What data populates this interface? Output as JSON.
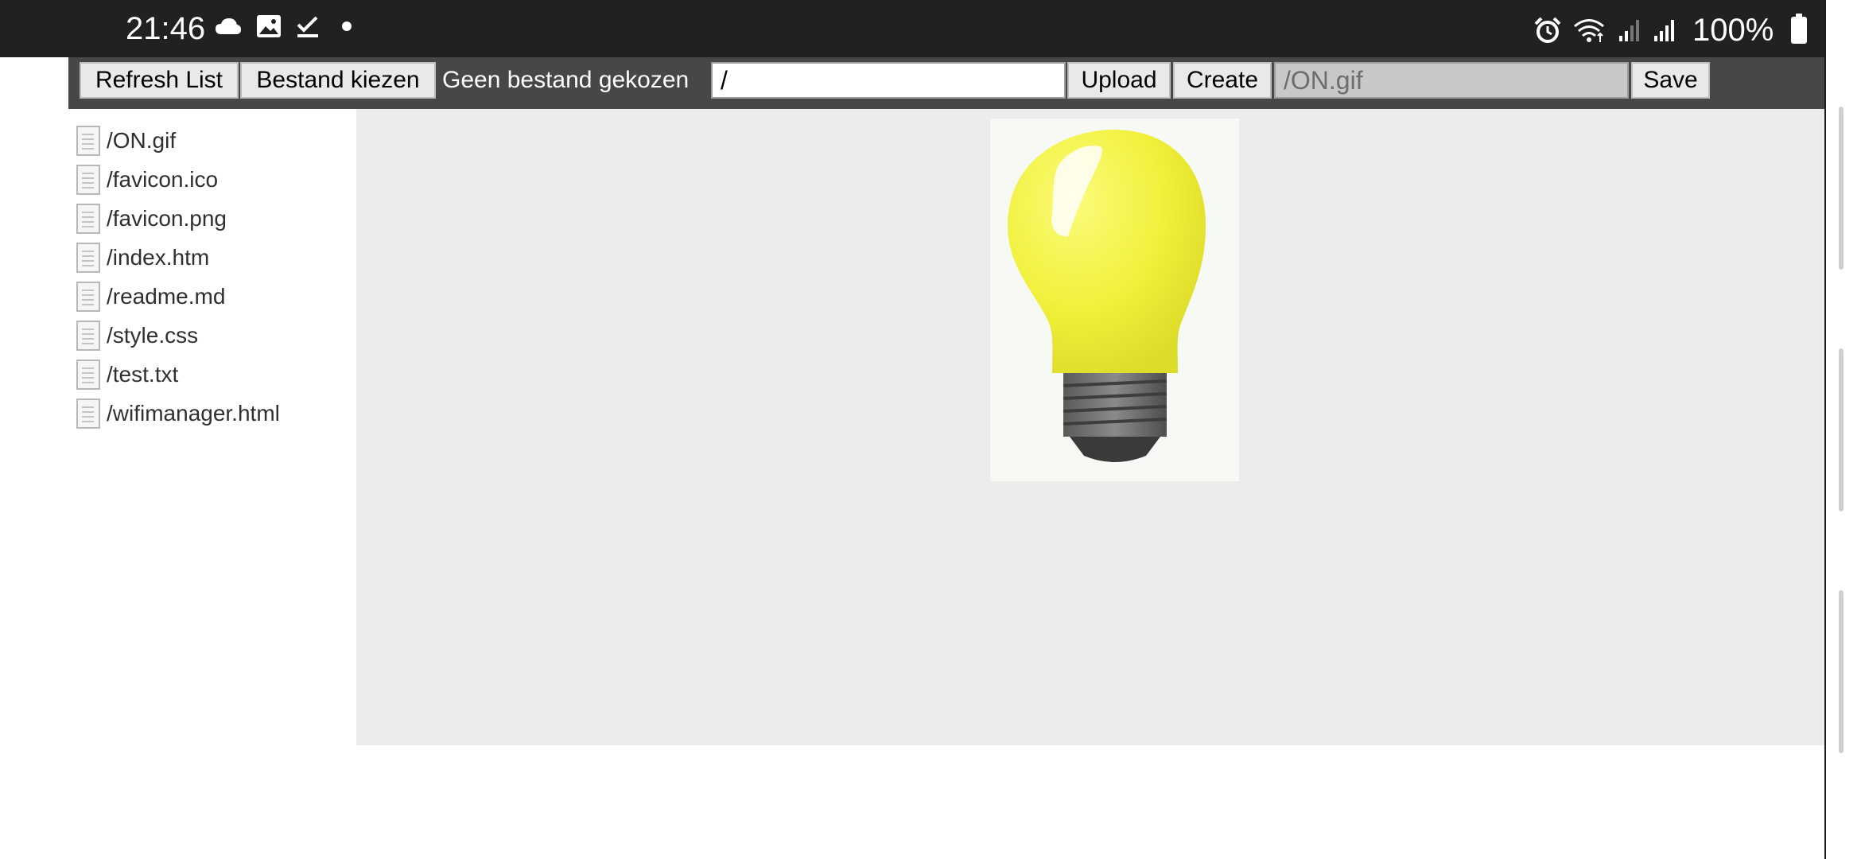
{
  "status_bar": {
    "time": "21:46",
    "left_icons": [
      "cloud-icon",
      "gallery-icon",
      "check-icon",
      "dot-icon"
    ],
    "right_icons": [
      "alarm-icon",
      "wifi-icon",
      "signal-icon",
      "signal-icon"
    ],
    "battery": "100%"
  },
  "toolbar": {
    "refresh_label": "Refresh List",
    "choose_file_label": "Bestand kiezen",
    "no_file_text": "Geen bestand gekozen",
    "path_value": "/",
    "upload_label": "Upload",
    "create_label": "Create",
    "edit_path_value": "/ON.gif",
    "save_label": "Save"
  },
  "files": [
    {
      "name": "/ON.gif"
    },
    {
      "name": "/favicon.ico"
    },
    {
      "name": "/favicon.png"
    },
    {
      "name": "/index.htm"
    },
    {
      "name": "/readme.md"
    },
    {
      "name": "/style.css"
    },
    {
      "name": "/test.txt"
    },
    {
      "name": "/wifimanager.html"
    }
  ],
  "preview": {
    "image": "lightbulb-icon",
    "colors": {
      "bulb": "#f0f03a",
      "base": "#6b6b6b"
    }
  }
}
